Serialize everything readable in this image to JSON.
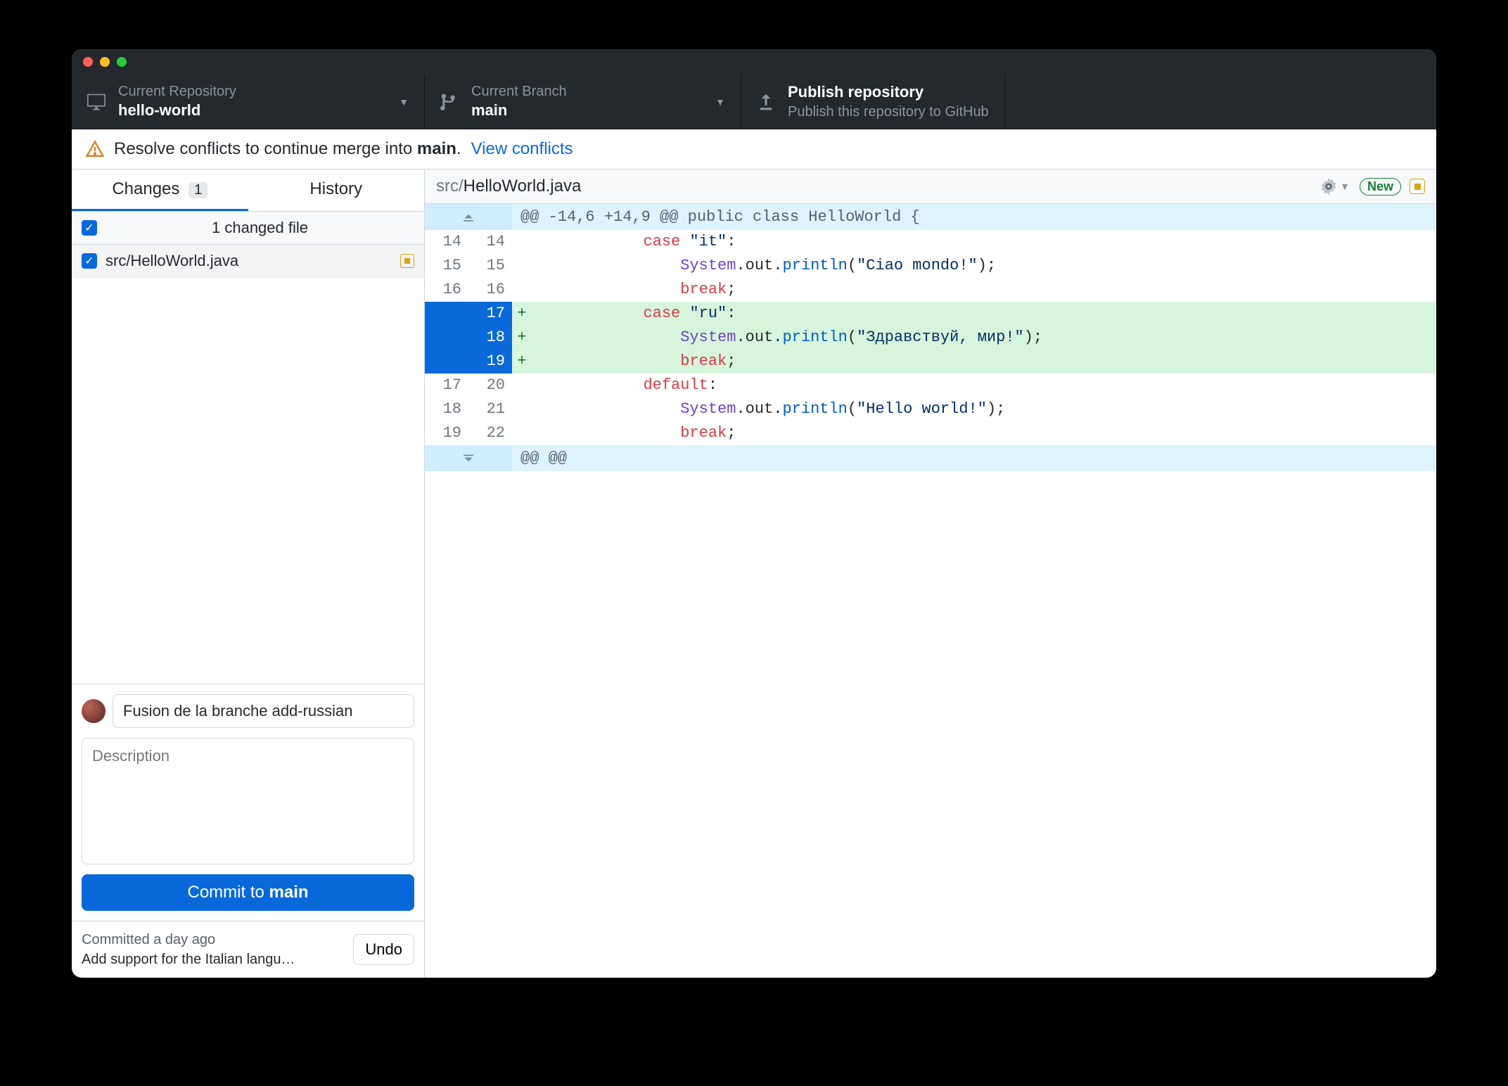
{
  "toolbar": {
    "repo": {
      "label": "Current Repository",
      "value": "hello-world"
    },
    "branch": {
      "label": "Current Branch",
      "value": "main"
    },
    "publish": {
      "label": "Publish repository",
      "sub": "Publish this repository to GitHub"
    }
  },
  "banner": {
    "text_before": "Resolve conflicts to continue merge into ",
    "branch": "main",
    "link": "View conflicts"
  },
  "tabs": {
    "changes": "Changes",
    "changes_count": "1",
    "history": "History"
  },
  "changes": {
    "header": "1 changed file",
    "file": "src/HelloWorld.java"
  },
  "commit": {
    "summary": "Fusion de la branche add-russian",
    "description_placeholder": "Description",
    "button_prefix": "Commit to ",
    "button_branch": "main"
  },
  "undo": {
    "time": "Committed a day ago",
    "title": "Add support for the Italian langu…",
    "button": "Undo"
  },
  "diff": {
    "path_dir": "src/",
    "path_file": "HelloWorld.java",
    "new_label": "New",
    "hunk1": "@@ -14,6 +14,9 @@ public class HelloWorld {",
    "hunk2": "@@ @@",
    "lines": [
      {
        "type": "ctx",
        "old": "14",
        "new": "14",
        "html": "            <span class='kw2'>case</span> <span class='str'>\"it\"</span>:"
      },
      {
        "type": "ctx",
        "old": "15",
        "new": "15",
        "html": "                <span class='cls'>System</span>.<span class='def'>out</span>.<span class='mth'>println</span>(<span class='str'>\"Ciao mondo!\"</span>);"
      },
      {
        "type": "ctx",
        "old": "16",
        "new": "16",
        "html": "                <span class='kw2'>break</span>;"
      },
      {
        "type": "add",
        "old": "",
        "new": "17",
        "html": "            <span class='kw2'>case</span> <span class='str'>\"ru\"</span>:"
      },
      {
        "type": "add",
        "old": "",
        "new": "18",
        "html": "                <span class='cls'>System</span>.<span class='def'>out</span>.<span class='mth'>println</span>(<span class='str'>\"Здравствуй, мир!\"</span>);"
      },
      {
        "type": "add",
        "old": "",
        "new": "19",
        "html": "                <span class='kw2'>break</span>;"
      },
      {
        "type": "ctx",
        "old": "17",
        "new": "20",
        "html": "            <span class='kw2'>default</span>:"
      },
      {
        "type": "ctx",
        "old": "18",
        "new": "21",
        "html": "                <span class='cls'>System</span>.<span class='def'>out</span>.<span class='mth'>println</span>(<span class='str'>\"Hello world!\"</span>);"
      },
      {
        "type": "ctx",
        "old": "19",
        "new": "22",
        "html": "                <span class='kw2'>break</span>;"
      }
    ]
  }
}
